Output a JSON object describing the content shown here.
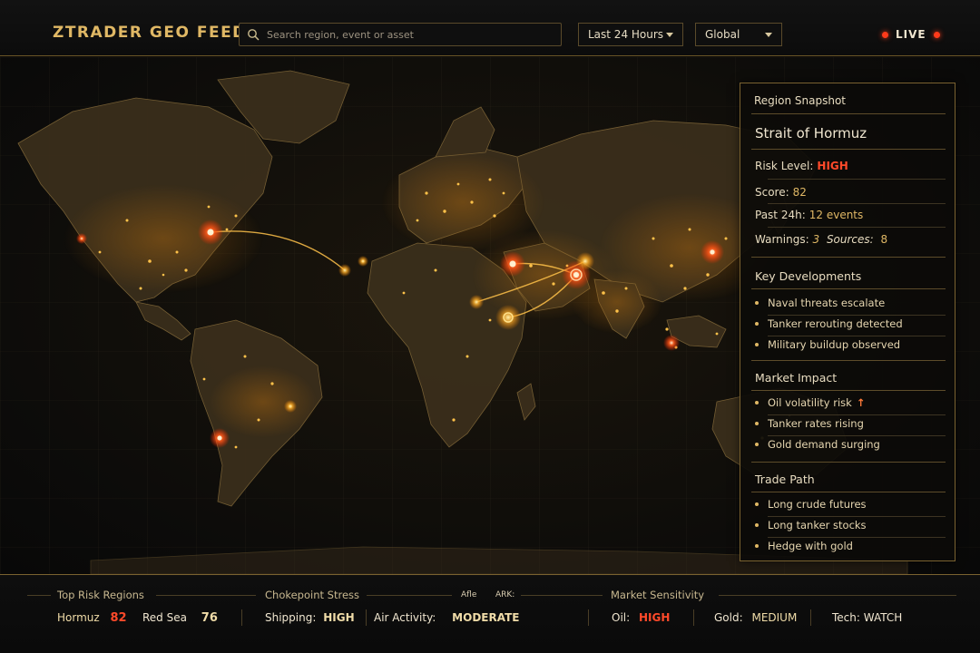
{
  "header": {
    "brand": "ZTRADER GEO FEED",
    "search_placeholder": "Search region, event or asset",
    "time_filter": "Last 24 Hours",
    "scope_filter": "Global",
    "live_label": "LIVE"
  },
  "panel": {
    "title": "Region Snapshot",
    "region": "Strait of Hormuz",
    "risk_label": "Risk Level:",
    "risk_value": "HIGH",
    "score_label": "Score:",
    "score_value": "82",
    "past_label": "Past 24h:",
    "past_value": "12 events",
    "warnings_label": "Warnings:",
    "warnings_value": "3",
    "sources_label": "Sources:",
    "sources_value": "8",
    "key_dev_title": "Key Developments",
    "key_dev": [
      "Naval threats escalate",
      "Tanker rerouting detected",
      "Military buildup observed"
    ],
    "market_title": "Market Impact",
    "market": [
      "Oil volatility risk",
      "Tanker rates rising",
      "Gold demand surging"
    ],
    "trade_title": "Trade Path",
    "trade": [
      "Long crude futures",
      "Long tanker stocks",
      "Hedge with gold"
    ]
  },
  "footer": {
    "top_risk_title": "Top Risk Regions",
    "region1_name": "Hormuz",
    "region1_score": "82",
    "region2_name": "Red Sea",
    "region2_score": "76",
    "choke_title": "Chokepoint Stress",
    "tiny1": "Afle",
    "tiny2": "ARK:",
    "shipping_label": "Shipping:",
    "shipping_value": "HIGH",
    "air_label": "Air Activity:",
    "air_value": "MODERATE",
    "sens_title": "Market Sensitivity",
    "oil_label": "Oil:",
    "oil_value": "HIGH",
    "gold_label": "Gold:",
    "gold_value": "MEDIUM",
    "tech_label": "Tech:",
    "tech_value": "WATCH"
  },
  "colors": {
    "accent_gold": "#e0b865",
    "alert_red": "#ff4a2a",
    "panel_border": "#7a6230"
  },
  "icons": {
    "search": "search-icon",
    "dropdown": "chevron-down-icon",
    "live": "live-dot-icon"
  }
}
